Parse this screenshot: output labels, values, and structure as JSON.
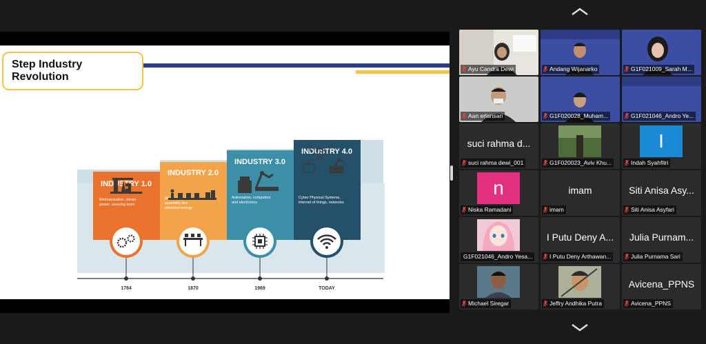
{
  "slide": {
    "title": "Step Industry Revolution",
    "steps": [
      {
        "label": "INDUSTRY 1.0",
        "desc": [
          "Mechanization, steam",
          "power, weaving loom"
        ],
        "year": "1784",
        "color": "#e9722d"
      },
      {
        "label": "INDUSTRY 2.0",
        "desc": [
          "Mass production,",
          "assembly line",
          "electrical energy"
        ],
        "year": "1870",
        "color": "#f3a44a"
      },
      {
        "label": "INDUSTRY 3.0",
        "desc": [
          "Automation, computers",
          "and electronics"
        ],
        "year": "1969",
        "color": "#3d8fa8"
      },
      {
        "label": "INDUSTRY 4.0",
        "desc": [
          "Cyber Physical Systems,",
          "internet of things, networks"
        ],
        "year": "TODAY",
        "color": "#245169"
      }
    ],
    "icons": [
      "oil-pump-icon",
      "conveyor-icon",
      "robot-arm-icon",
      "iot-icon"
    ]
  },
  "gallery": {
    "participants": [
      {
        "name": "Ayu Candra Dewi",
        "type": "video",
        "speaking": true
      },
      {
        "name": "Andang Wijanarko",
        "type": "video",
        "speaking": false
      },
      {
        "name": "G1F021009_Sarah M...",
        "type": "video",
        "speaking": false
      },
      {
        "name": "Aan erlansari",
        "type": "video",
        "speaking": false
      },
      {
        "name": "G1F020028_Muham...",
        "type": "video",
        "speaking": false
      },
      {
        "name": "G1F021046_Andro Ye...",
        "type": "video",
        "speaking": false
      },
      {
        "name": "suci rahma dewi_001",
        "display": "suci rahma d...",
        "type": "name"
      },
      {
        "name": "G1F020023_Aviv Khu...",
        "type": "photo"
      },
      {
        "name": "Indah Syahfitri",
        "type": "letter",
        "letter": "I",
        "bg": "#1a8ad6"
      },
      {
        "name": "Niska Ramadani",
        "type": "letter",
        "letter": "n",
        "bg": "#e3307f"
      },
      {
        "name": "imam",
        "display": "imam",
        "type": "name"
      },
      {
        "name": "Siti Anisa Asyfari",
        "display": "Siti Anisa Asy...",
        "type": "name"
      },
      {
        "name": "G1F021046_Andro Yesa...",
        "type": "photo"
      },
      {
        "name": "I Putu Deny Arthawan...",
        "display": "I Putu Deny A...",
        "type": "name"
      },
      {
        "name": "Julia Purnama Sari",
        "display": "Julia Purnam...",
        "type": "name"
      },
      {
        "name": "Michael Siregar",
        "type": "photo"
      },
      {
        "name": "Jeffry Andhika Putra",
        "type": "photo"
      },
      {
        "name": "Avicena_PPNS",
        "display": "Avicena_PPNS",
        "type": "name"
      }
    ]
  },
  "colors": {
    "speaking_border": "#d6e04f",
    "muted_mic": "#e0463d",
    "tile_bg": "#2b2b2b",
    "app_bg": "#1a1a1a"
  }
}
